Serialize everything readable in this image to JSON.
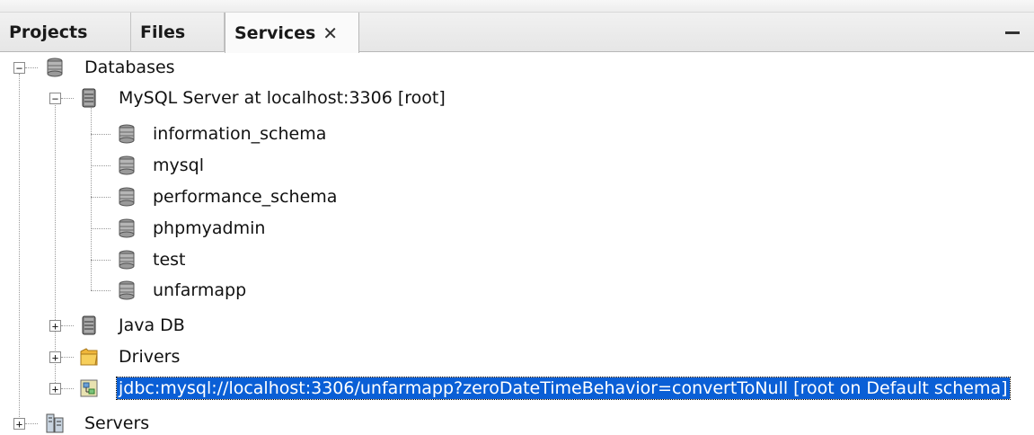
{
  "tabs": [
    {
      "label": "Projects"
    },
    {
      "label": "Files"
    },
    {
      "label": "Services",
      "close": "✕"
    }
  ],
  "tree": {
    "databases": "Databases",
    "mysql_server": "MySQL Server at localhost:3306 [root]",
    "schemas": [
      "information_schema",
      "mysql",
      "performance_schema",
      "phpmyadmin",
      "test",
      "unfarmapp"
    ],
    "java_db": "Java DB",
    "drivers": "Drivers",
    "connection": "jdbc:mysql://localhost:3306/unfarmapp?zeroDateTimeBehavior=convertToNull [root on Default schema]",
    "servers": "Servers"
  },
  "toggles": {
    "expanded": "−",
    "collapsed": "+"
  },
  "colors": {
    "selection": "#0a5fd6"
  },
  "icons": {
    "databases": "database-stack-icon",
    "mysql_server": "server-icon",
    "schema": "database-icon",
    "java_db": "server-icon",
    "drivers": "folder-icon",
    "connection": "connection-icon",
    "servers": "servers-icon"
  }
}
